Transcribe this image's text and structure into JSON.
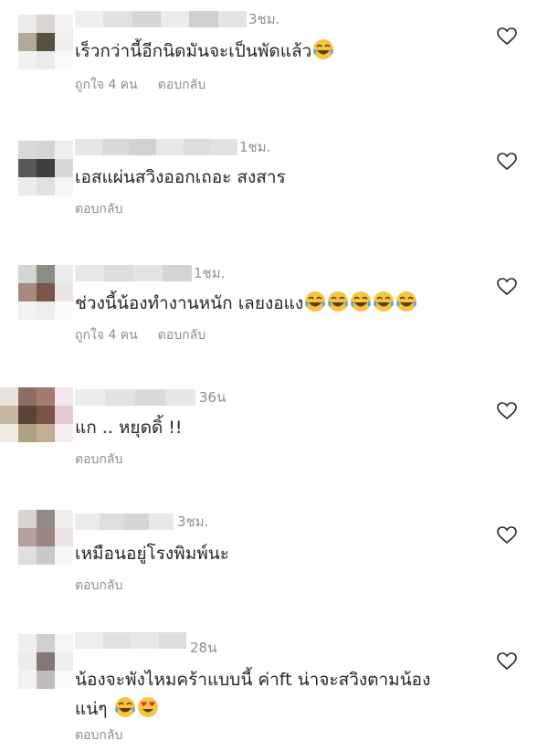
{
  "comments": [
    {
      "time": "3ชม.",
      "text": "เร็วกว่านี้อีกนิดมันจะเป็นพัดแล้ว",
      "emojis": [
        "tears-of-joy"
      ],
      "likes": "ถูกใจ 4 คน",
      "reply": "ตอบกลับ"
    },
    {
      "time": "1ชม.",
      "text": "เอสแผ่นสวิงออกเถอะ สงสาร",
      "emojis": [],
      "likes": "",
      "reply": "ตอบกลับ"
    },
    {
      "time": "1ชม.",
      "text": "ช่วงนี้น้องทำงานหนัก เลยงอแง",
      "emojis": [
        "tears-of-joy",
        "tears-of-joy",
        "tears-of-joy",
        "tears-of-joy",
        "tears-of-joy"
      ],
      "likes": "ถูกใจ 4 คน",
      "reply": "ตอบกลับ"
    },
    {
      "time": "36น",
      "text": "แก .. หยุดดิ้ !!",
      "emojis": [],
      "likes": "",
      "reply": "ตอบกลับ"
    },
    {
      "time": "3ชม.",
      "text": "เหมือนอยู่โรงพิมพ์นะ",
      "emojis": [],
      "likes": "",
      "reply": "ตอบกลับ"
    },
    {
      "time": "28น",
      "text": "น้องจะพังไหมคร้าแบบนี้ ค่าft น่าจะสวิงตามน้อง",
      "text2": "แน่ๆ",
      "emojis": [
        "tears-of-joy",
        "heart-eyes"
      ],
      "likes": "",
      "reply": "ตอบกลับ"
    }
  ],
  "icons": {
    "like": "heart-outline-icon"
  },
  "colors": {
    "text": "#262626",
    "muted": "#8e8e8e"
  }
}
